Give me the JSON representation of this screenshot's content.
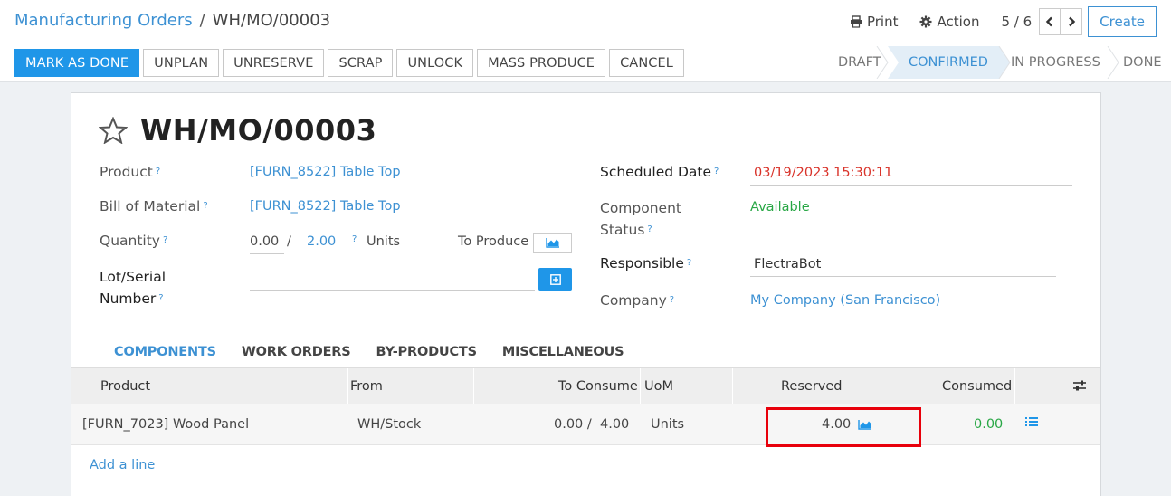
{
  "breadcrumb": {
    "parent": "Manufacturing Orders",
    "separator": "/",
    "current": "WH/MO/00003"
  },
  "top_actions": {
    "print": "Print",
    "action": "Action",
    "pager": "5 / 6",
    "create": "Create"
  },
  "buttons": [
    "MARK AS DONE",
    "UNPLAN",
    "UNRESERVE",
    "SCRAP",
    "UNLOCK",
    "MASS PRODUCE",
    "CANCEL"
  ],
  "statusbar": [
    "DRAFT",
    "CONFIRMED",
    "IN PROGRESS",
    "DONE"
  ],
  "form": {
    "title": "WH/MO/00003",
    "product_label": "Product",
    "product_value": "[FURN_8522] Table Top",
    "bom_label": "Bill of Material",
    "bom_value": "[FURN_8522] Table Top",
    "quantity_label": "Quantity",
    "quantity_produced": "0.00",
    "quantity_sep": "/",
    "quantity_total": "2.00",
    "quantity_unit": "Units",
    "to_produce": "To Produce",
    "lot_label_1": "Lot/Serial",
    "lot_label_2": "Number",
    "scheduled_label": "Scheduled Date",
    "scheduled_value": "03/19/2023 15:30:11",
    "component_status_label_1": "Component",
    "component_status_label_2": "Status",
    "component_status_value": "Available",
    "responsible_label": "Responsible",
    "responsible_value": "FlectraBot",
    "company_label": "Company",
    "company_value": "My Company (San Francisco)",
    "help_mark": "?"
  },
  "tabs": [
    "COMPONENTS",
    "WORK ORDERS",
    "BY-PRODUCTS",
    "MISCELLANEOUS"
  ],
  "table": {
    "headers": [
      "Product",
      "From",
      "To Consume",
      "UoM",
      "Reserved",
      "Consumed"
    ],
    "rows": [
      {
        "product": "[FURN_7023] Wood Panel",
        "from": "WH/Stock",
        "to_consume": "0.00 /  4.00",
        "uom": "Units",
        "reserved": "4.00",
        "consumed": "0.00"
      }
    ],
    "add_line": "Add a line"
  },
  "colors": {
    "primary": "#1f96e8",
    "link": "#3d91d3",
    "highlight": "#e8000b",
    "available": "#28a745",
    "date": "#d9332a"
  }
}
